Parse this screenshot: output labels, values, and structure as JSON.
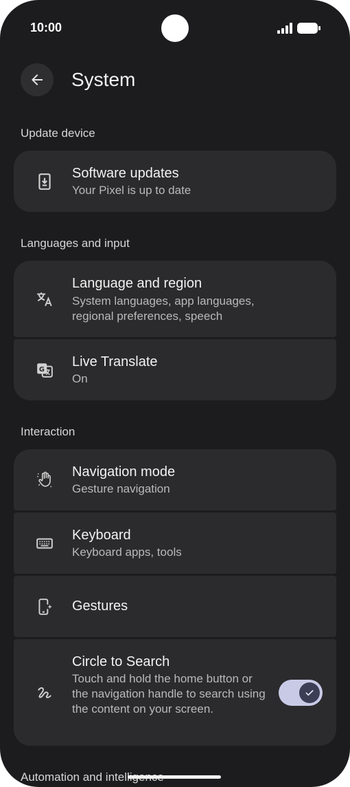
{
  "status_bar": {
    "time": "10:00"
  },
  "header": {
    "title": "System"
  },
  "sections": {
    "update_device": {
      "header": "Update device",
      "software_updates": {
        "title": "Software updates",
        "subtitle": "Your Pixel is up to date"
      }
    },
    "languages_input": {
      "header": "Languages and input",
      "language_region": {
        "title": "Language and region",
        "subtitle": "System languages, app languages, regional preferences, speech"
      },
      "live_translate": {
        "title": "Live Translate",
        "subtitle": "On"
      }
    },
    "interaction": {
      "header": "Interaction",
      "navigation_mode": {
        "title": "Navigation mode",
        "subtitle": "Gesture navigation"
      },
      "keyboard": {
        "title": "Keyboard",
        "subtitle": "Keyboard apps, tools"
      },
      "gestures": {
        "title": "Gestures"
      },
      "circle_to_search": {
        "title": "Circle to Search",
        "subtitle": "Touch and hold the home button or the navigation handle to search using the content on your screen.",
        "enabled": true
      }
    },
    "automation": {
      "header": "Automation and intelligence"
    }
  },
  "icons": {
    "back": "arrow-back-icon",
    "software_updates": "phone-download-icon",
    "language_region": "translate-icon",
    "live_translate": "google-translate-icon",
    "navigation_mode": "gesture-hand-icon",
    "keyboard": "keyboard-icon",
    "gestures": "phone-sparkle-icon",
    "circle_to_search": "squiggle-icon",
    "toggle_check": "check-icon"
  },
  "colors": {
    "background": "#1c1c1e",
    "card": "#2b2b2d",
    "toggle_track": "#c9cbe6",
    "toggle_knob": "#3b3e55"
  }
}
